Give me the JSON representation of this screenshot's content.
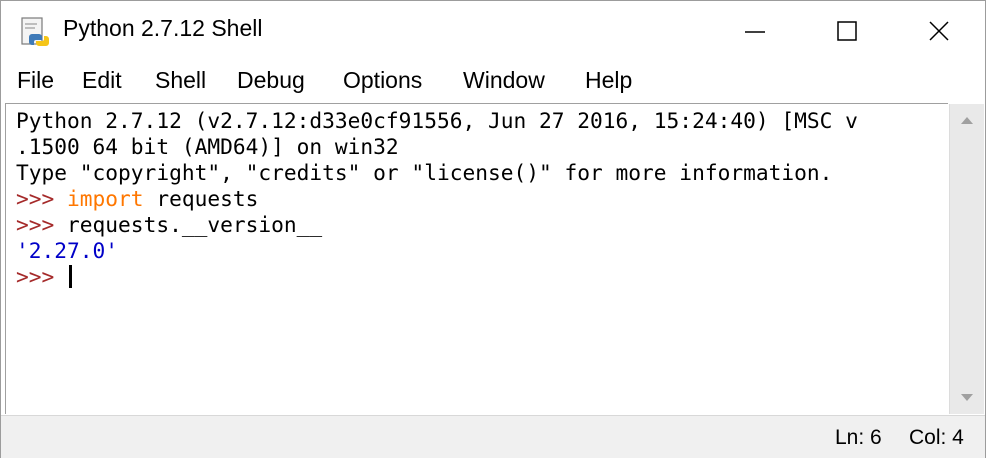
{
  "window": {
    "title": "Python 2.7.12 Shell",
    "app_icon": "python-idle-icon",
    "controls": {
      "minimize_icon": "minimize-icon",
      "maximize_icon": "maximize-icon",
      "close_icon": "close-icon"
    }
  },
  "menu": {
    "items": [
      "File",
      "Edit",
      "Shell",
      "Debug",
      "Options",
      "Window",
      "Help"
    ]
  },
  "shell": {
    "banner_line1": "Python 2.7.12 (v2.7.12:d33e0cf91556, Jun 27 2016, 15:24:40) [MSC v",
    "banner_line2": ".1500 64 bit (AMD64)] on win32",
    "banner_line3": "Type \"copyright\", \"credits\" or \"license()\" for more information.",
    "prompt": ">>> ",
    "cmd1_keyword": "import",
    "cmd1_rest": " requests",
    "cmd2": "requests.__version__",
    "output": "'2.27.0'"
  },
  "statusbar": {
    "line": "Ln: 6",
    "column": "Col: 4"
  },
  "colors": {
    "prompt": "#a52a2a",
    "keyword": "#ff7700",
    "output": "#0000c8",
    "text": "#000000"
  }
}
